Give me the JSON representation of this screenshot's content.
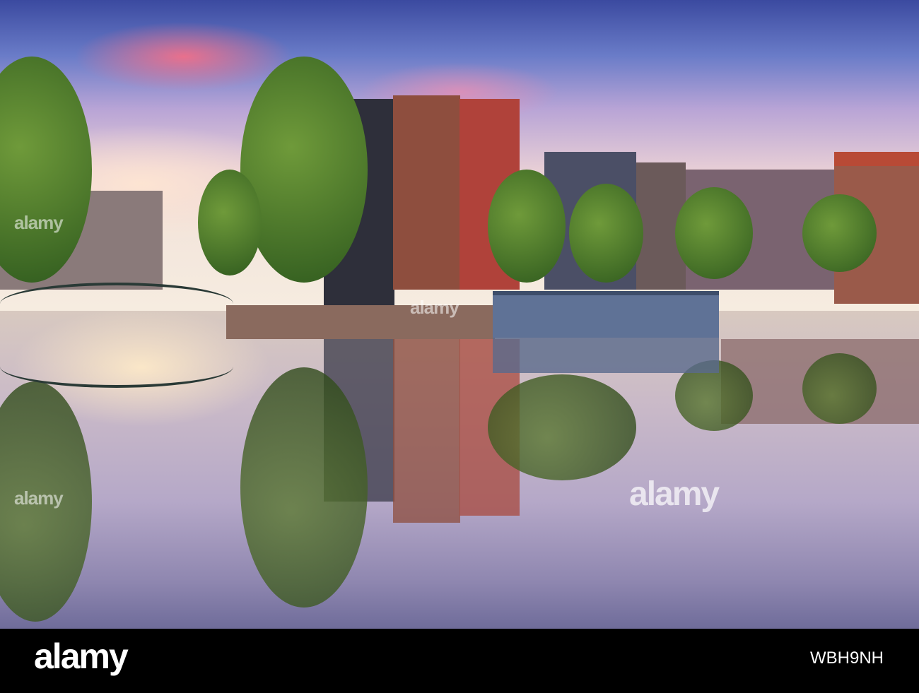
{
  "photo": {
    "subject": "Amsterdam canal houses at sunset reflected in water",
    "colors": {
      "sky_top": "#3b4aa0",
      "sky_pink": "#ff6e82",
      "water": "#b5a8c8",
      "houseboat": "#5f7296"
    }
  },
  "watermark": {
    "text": "alamy"
  },
  "footer": {
    "logo": "alamy",
    "image_id": "WBH9NH"
  }
}
